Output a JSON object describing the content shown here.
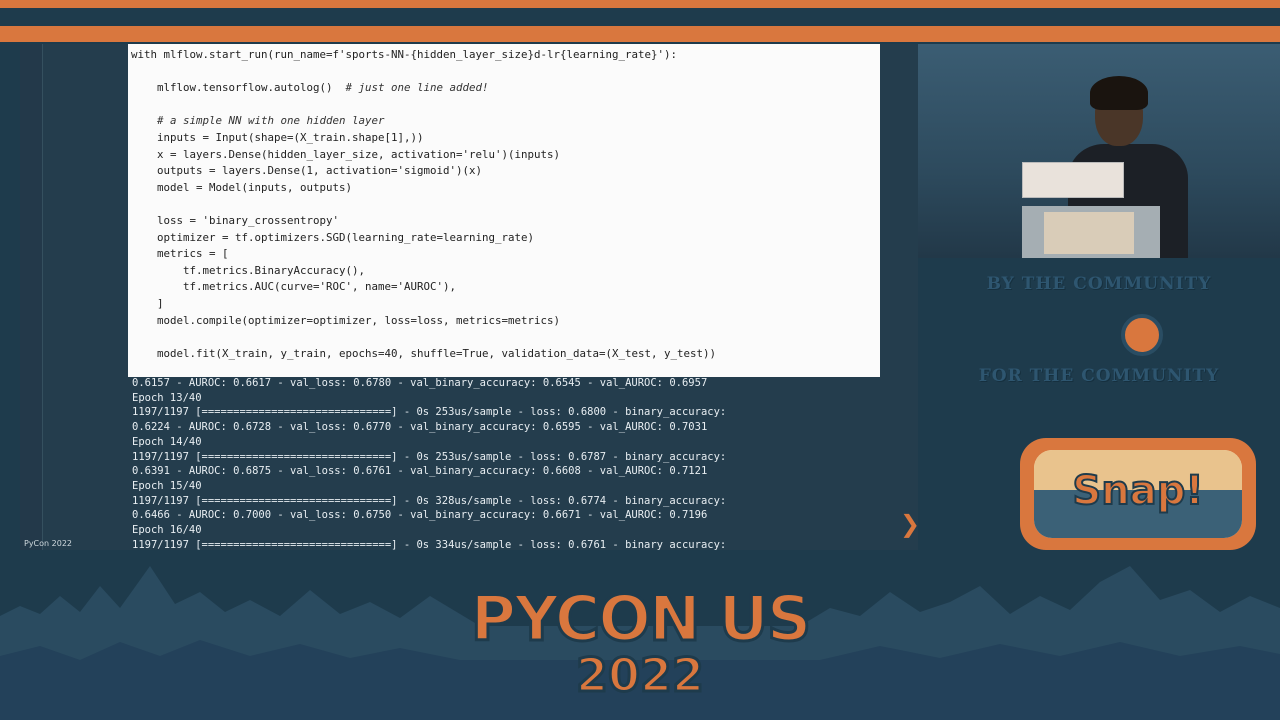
{
  "code": [
    {
      "t": "with mlflow.start_run(run_name=f'sports-NN-{hidden_layer_size}d-lr{learning_rate}'):",
      "kind": "code"
    },
    {
      "t": "",
      "kind": "code"
    },
    {
      "t": "    mlflow.tensorflow.autolog()  ",
      "cm": "# just one line added!",
      "kind": "code"
    },
    {
      "t": "",
      "kind": "code"
    },
    {
      "t": "    ",
      "cm": "# a simple NN with one hidden layer",
      "kind": "code"
    },
    {
      "t": "    inputs = Input(shape=(X_train.shape[1],))",
      "kind": "code"
    },
    {
      "t": "    x = layers.Dense(hidden_layer_size, activation='relu')(inputs)",
      "kind": "code"
    },
    {
      "t": "    outputs = layers.Dense(1, activation='sigmoid')(x)",
      "kind": "code"
    },
    {
      "t": "    model = Model(inputs, outputs)",
      "kind": "code"
    },
    {
      "t": "",
      "kind": "code"
    },
    {
      "t": "    loss = 'binary_crossentropy'",
      "kind": "code"
    },
    {
      "t": "    optimizer = tf.optimizers.SGD(learning_rate=learning_rate)",
      "kind": "code"
    },
    {
      "t": "    metrics = [",
      "kind": "code"
    },
    {
      "t": "        tf.metrics.BinaryAccuracy(),",
      "kind": "code"
    },
    {
      "t": "        tf.metrics.AUC(curve='ROC', name='AUROC'),",
      "kind": "code"
    },
    {
      "t": "    ]",
      "kind": "code"
    },
    {
      "t": "    model.compile(optimizer=optimizer, loss=loss, metrics=metrics)",
      "kind": "code"
    },
    {
      "t": "",
      "kind": "code"
    },
    {
      "t": "    model.fit(X_train, y_train, epochs=40, shuffle=True, validation_data=(X_test, y_test))",
      "kind": "code"
    }
  ],
  "terminal": [
    "0.6157 - AUROC: 0.6617 - val_loss: 0.6780 - val_binary_accuracy: 0.6545 - val_AUROC: 0.6957",
    "Epoch 13/40",
    "1197/1197 [==============================] - 0s 253us/sample - loss: 0.6800 - binary_accuracy:",
    "0.6224 - AUROC: 0.6728 - val_loss: 0.6770 - val_binary_accuracy: 0.6595 - val_AUROC: 0.7031",
    "Epoch 14/40",
    "1197/1197 [==============================] - 0s 253us/sample - loss: 0.6787 - binary_accuracy:",
    "0.6391 - AUROC: 0.6875 - val_loss: 0.6761 - val_binary_accuracy: 0.6608 - val_AUROC: 0.7121",
    "Epoch 15/40",
    "1197/1197 [==============================] - 0s 328us/sample - loss: 0.6774 - binary_accuracy:",
    "0.6466 - AUROC: 0.7000 - val_loss: 0.6750 - val_binary_accuracy: 0.6671 - val_AUROC: 0.7196",
    "Epoch 16/40",
    "1197/1197 [==============================] - 0s 334us/sample - loss: 0.6761 - binary_accuracy:"
  ],
  "slide_footer": "PyCon 2022",
  "tagline_top": "BY THE COMMUNITY",
  "tagline_bottom": "FOR THE COMMUNITY",
  "badge_word": "Snap!",
  "event_title": "PYCON US",
  "event_year": "2022",
  "colors": {
    "accent": "#d9773e",
    "background": "#1e3b4c",
    "code_bg": "#fbfbfb"
  },
  "icons": {
    "next": "chevron-right-icon"
  }
}
